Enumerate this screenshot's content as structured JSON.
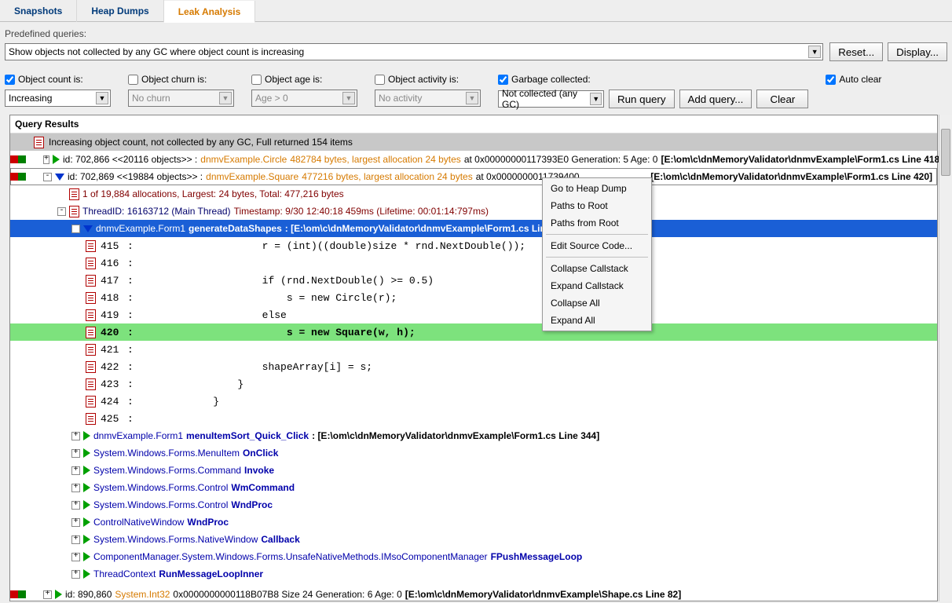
{
  "tabs": [
    "Snapshots",
    "Heap Dumps",
    "Leak Analysis"
  ],
  "activeTab": 2,
  "queryLabel": "Predefined queries:",
  "queryText": "Show objects not collected by any GC where object count is increasing",
  "buttons": {
    "reset": "Reset...",
    "display": "Display...",
    "run": "Run query",
    "addQuery": "Add query...",
    "clear": "Clear"
  },
  "filters": {
    "countChecked": true,
    "countLbl": "Object count is:",
    "countVal": "Increasing",
    "churnChecked": false,
    "churnLbl": "Object churn is:",
    "churnVal": "No churn",
    "ageChecked": false,
    "ageLbl": "Object age is:",
    "ageVal": "Age > 0",
    "activityChecked": false,
    "activityLbl": "Object activity is:",
    "activityVal": "No activity",
    "gcChecked": true,
    "gcLbl": "Garbage collected:",
    "gcVal": "Not collected (any GC)",
    "autoClearChecked": true,
    "autoClearLbl": "Auto clear"
  },
  "results": {
    "title": "Query Results",
    "banner": "Increasing object count, not collected by any GC, Full returned 154 items",
    "row1": {
      "id": "id: 702,866 <<20116 objects>> :",
      "type": "dnmvExample.Circle",
      "bytes": "482784 bytes, largest allocation 24 bytes",
      "addr": "at 0x00000000117393E0 Generation: 5 Age: 0",
      "loc": "[E:\\om\\c\\dnMemoryValidator\\dnmvExample\\Form1.cs Line 418]"
    },
    "row2": {
      "id": "id: 702,869 <<19884 objects>> :",
      "type": "dnmvExample.Square",
      "bytes": "477216 bytes, largest allocation 24 bytes",
      "addr": "at 0x0000000011739400",
      "loc": "[E:\\om\\c\\dnMemoryValidator\\dnmvExample\\Form1.cs Line 420]"
    },
    "alloc": "1 of 19,884 allocations, Largest: 24 bytes, Total: 477,216 bytes",
    "thread": {
      "a": "ThreadID: 16163712  (Main Thread) ",
      "b": "Timestamp: 9/30 12:40:18 459ms (Lifetime: 00:01:14:797ms)"
    },
    "gensel": {
      "a": "dnmvExample.Form1 ",
      "b": "generateDataShapes",
      "c": " : [E:\\om\\c\\dnMemoryValidator\\dnmvExample\\Form1.cs Line"
    },
    "code": [
      {
        "n": "415",
        "t": "                   r = (int)((double)size * rnd.NextDouble());"
      },
      {
        "n": "416",
        "t": ""
      },
      {
        "n": "417",
        "t": "                   if (rnd.NextDouble() >= 0.5)"
      },
      {
        "n": "418",
        "t": "                       s = new Circle(r);"
      },
      {
        "n": "419",
        "t": "                   else"
      },
      {
        "n": "420",
        "t": "                       s = new Square(w, h);",
        "hl": true
      },
      {
        "n": "421",
        "t": ""
      },
      {
        "n": "422",
        "t": "                   shapeArray[i] = s;"
      },
      {
        "n": "423",
        "t": "               }"
      },
      {
        "n": "424",
        "t": "           }"
      },
      {
        "n": "425",
        "t": ""
      }
    ],
    "stack": [
      {
        "class": "dnmvExample.Form1",
        "method": "menuItemSort_Quick_Click",
        "loc": " : [E:\\om\\c\\dnMemoryValidator\\dnmvExample\\Form1.cs Line 344]"
      },
      {
        "class": "System.Windows.Forms.MenuItem",
        "method": "OnClick"
      },
      {
        "class": "System.Windows.Forms.Command",
        "method": "Invoke"
      },
      {
        "class": "System.Windows.Forms.Control",
        "method": "WmCommand"
      },
      {
        "class": "System.Windows.Forms.Control",
        "method": "WndProc"
      },
      {
        "class": "ControlNativeWindow",
        "method": "WndProc"
      },
      {
        "class": "System.Windows.Forms.NativeWindow",
        "method": "Callback"
      },
      {
        "class": "ComponentManager.System.Windows.Forms.UnsafeNativeMethods.IMsoComponentManager",
        "method": "FPushMessageLoop"
      },
      {
        "class": "ThreadContext",
        "method": "RunMessageLoopInner"
      }
    ],
    "row3": {
      "id": "id: 890,860",
      "type": "System.Int32",
      "rest": "0x0000000000118B07B8 Size 24 Generation: 6 Age: 0",
      "loc": "[E:\\om\\c\\dnMemoryValidator\\dnmvExample\\Shape.cs Line 82]"
    }
  },
  "menu": [
    "Go to Heap Dump",
    "Paths to Root",
    "Paths from Root",
    "---",
    "Edit Source Code...",
    "---",
    "Collapse Callstack",
    "Expand Callstack",
    "Collapse All",
    "Expand All"
  ]
}
